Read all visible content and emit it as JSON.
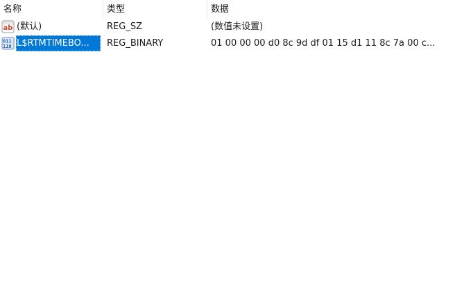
{
  "columns": {
    "name": "名称",
    "type": "类型",
    "data": "数据"
  },
  "rows": [
    {
      "icon": "string-value-icon",
      "name": "(默认)",
      "type": "REG_SZ",
      "data": "(数值未设置)",
      "selected": false
    },
    {
      "icon": "binary-value-icon",
      "name": "L$RTMTIMEBO...",
      "type": "REG_BINARY",
      "data": "01 00 00 00 d0 8c 9d df 01 15 d1 11 8c 7a 00 c...",
      "selected": true
    }
  ],
  "colors": {
    "selection": "#0078d7",
    "string_icon_red": "#c9462c",
    "binary_icon_blue": "#2f64b5"
  }
}
